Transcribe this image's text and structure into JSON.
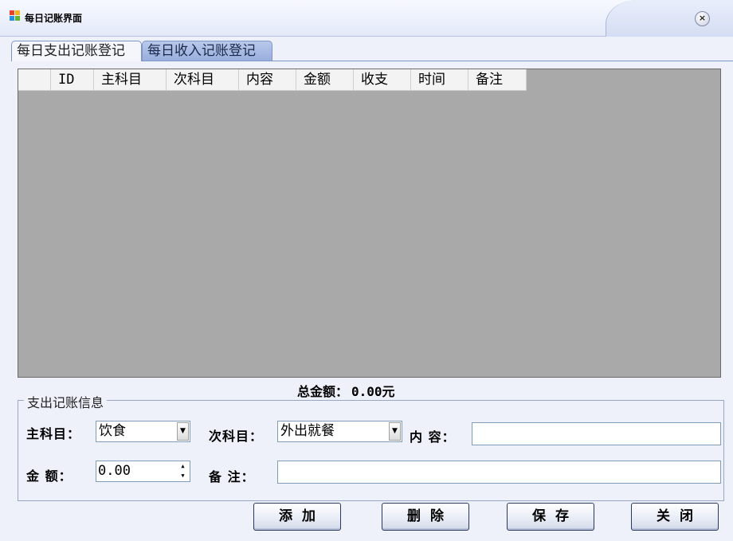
{
  "window": {
    "title": "每日记账界面",
    "close_symbol": "×"
  },
  "tabs": [
    {
      "label": "每日支出记账登记",
      "selected": true
    },
    {
      "label": "每日收入记账登记",
      "selected": false
    }
  ],
  "grid": {
    "columns": [
      "",
      "ID",
      "主科目",
      "次科目",
      "内容",
      "金额",
      "收支",
      "时间",
      "备注"
    ],
    "rows": []
  },
  "summary": {
    "total_label": "总金额：",
    "total_value": "0.00元"
  },
  "form": {
    "group_title": "支出记账信息",
    "main_category_label": "主科目：",
    "main_category_value": "饮食",
    "sub_category_label": "次科目：",
    "sub_category_value": "外出就餐",
    "content_label": "内 容：",
    "content_value": "",
    "amount_label": "金 额：",
    "amount_value": "0.00",
    "remark_label": "备 注：",
    "remark_value": ""
  },
  "buttons": {
    "add": "添加",
    "delete": "删除",
    "save": "保存",
    "close": "关闭"
  },
  "colors": {
    "grid_background": "#a9a9a9",
    "window_background": "#eef1fa",
    "selected_tab": "#f4f6fc",
    "unselected_tab": "#a6b8e2"
  }
}
